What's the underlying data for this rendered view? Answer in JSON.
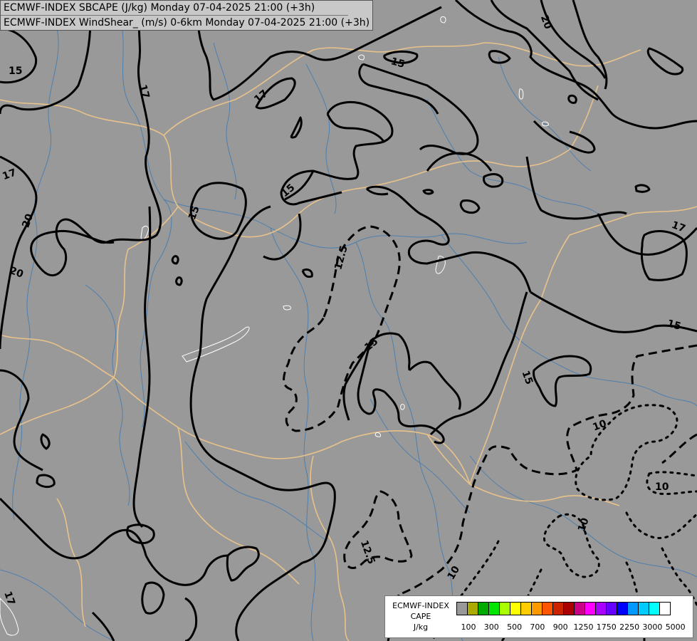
{
  "title": {
    "line1": "ECMWF-INDEX SBCAPE (J/kg) Monday 07-04-2025 21:00 (+3h)",
    "line2": "ECMWF-INDEX WindShear_ (m/s) 0-6km Monday 07-04-2025 21:00 (+3h)"
  },
  "legend": {
    "label_line1": "ECMWF-INDEX",
    "label_line2": "CAPE",
    "label_line3": "J/kg",
    "colors": [
      "#999999",
      "#aaaa00",
      "#00aa00",
      "#00e600",
      "#aaff00",
      "#ffff00",
      "#ffcc00",
      "#ff9900",
      "#ff5500",
      "#cc2200",
      "#aa0000",
      "#cc0088",
      "#ff00ff",
      "#aa00ff",
      "#6600ff",
      "#0000ff",
      "#0099ff",
      "#00ccff",
      "#00ffff",
      "#ffffff"
    ],
    "ticks": [
      "100",
      "300",
      "500",
      "700",
      "900",
      "1250",
      "1750",
      "2250",
      "3000",
      "5000"
    ]
  },
  "contour_labels": [
    "15",
    "17",
    "17",
    "17",
    "20",
    "20",
    "20",
    "15",
    "15",
    "15",
    "12.5",
    "15",
    "17",
    "15",
    "15",
    "10",
    "10",
    "10",
    "10",
    "12.5",
    "17"
  ]
}
